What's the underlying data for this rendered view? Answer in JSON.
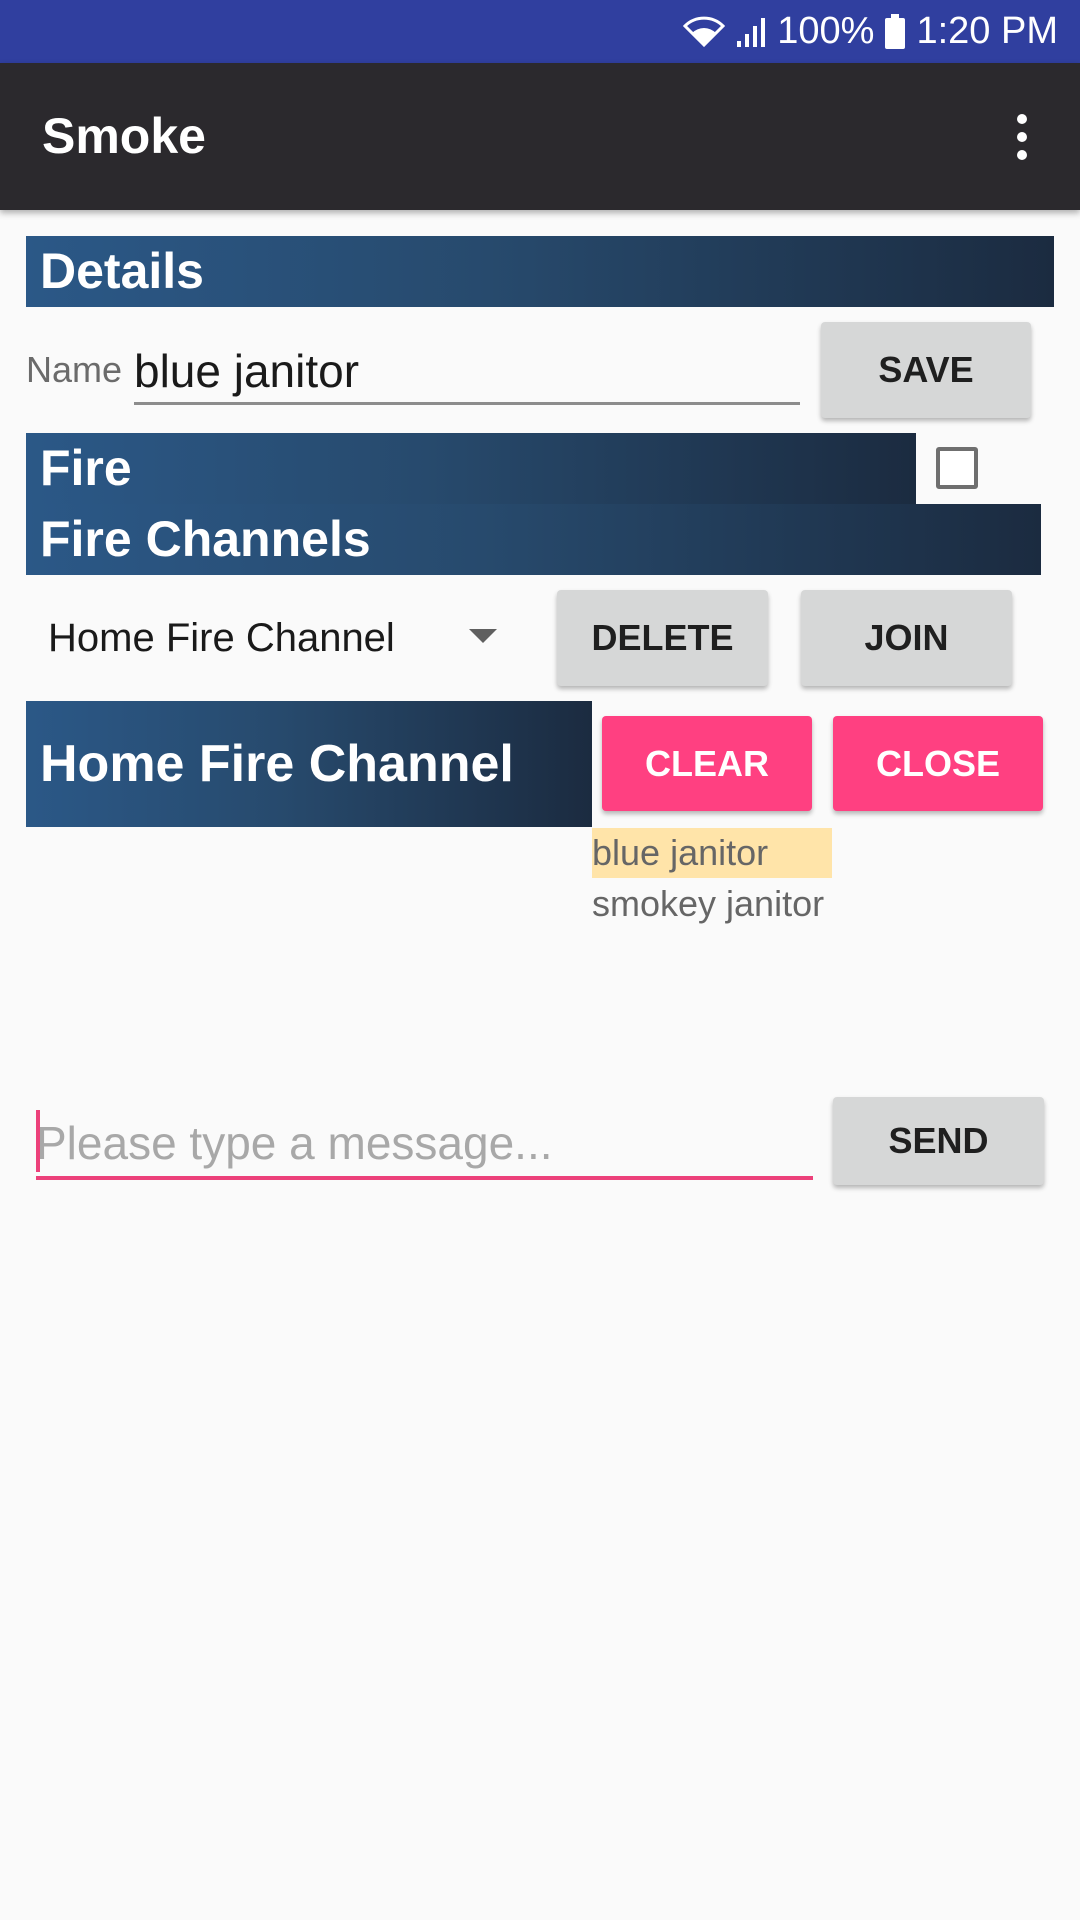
{
  "status_bar": {
    "battery": "100%",
    "time": "1:20 PM",
    "wifi_icon": "wifi-icon",
    "signal_icon": "signal-icon",
    "battery_icon": "battery-icon",
    "background_color": "#303f9f"
  },
  "app_bar": {
    "title": "Smoke",
    "overflow_icon": "more-vert-icon",
    "background_color": "#2b292d"
  },
  "details": {
    "heading": "Details",
    "name_label": "Name",
    "name_value": "blue janitor",
    "save_label": "SAVE"
  },
  "fire": {
    "heading": "Fire",
    "checkbox_checked": false
  },
  "channels": {
    "heading": "Fire Channels",
    "selected_channel": "Home Fire Channel",
    "delete_label": "DELETE",
    "join_label": "JOIN"
  },
  "channel_view": {
    "heading": "Home Fire Channel",
    "clear_label": "CLEAR",
    "close_label": "CLOSE",
    "users": [
      {
        "name": "blue janitor",
        "highlighted": true
      },
      {
        "name": "smokey janitor",
        "highlighted": false
      }
    ]
  },
  "message": {
    "placeholder": "Please type a message...",
    "value": "",
    "send_label": "SEND"
  },
  "colors": {
    "accent": "#ff4081",
    "highlight": "#ffe4a9",
    "header_gradient_start": "#2b5887",
    "header_gradient_end": "#1b2b40"
  }
}
